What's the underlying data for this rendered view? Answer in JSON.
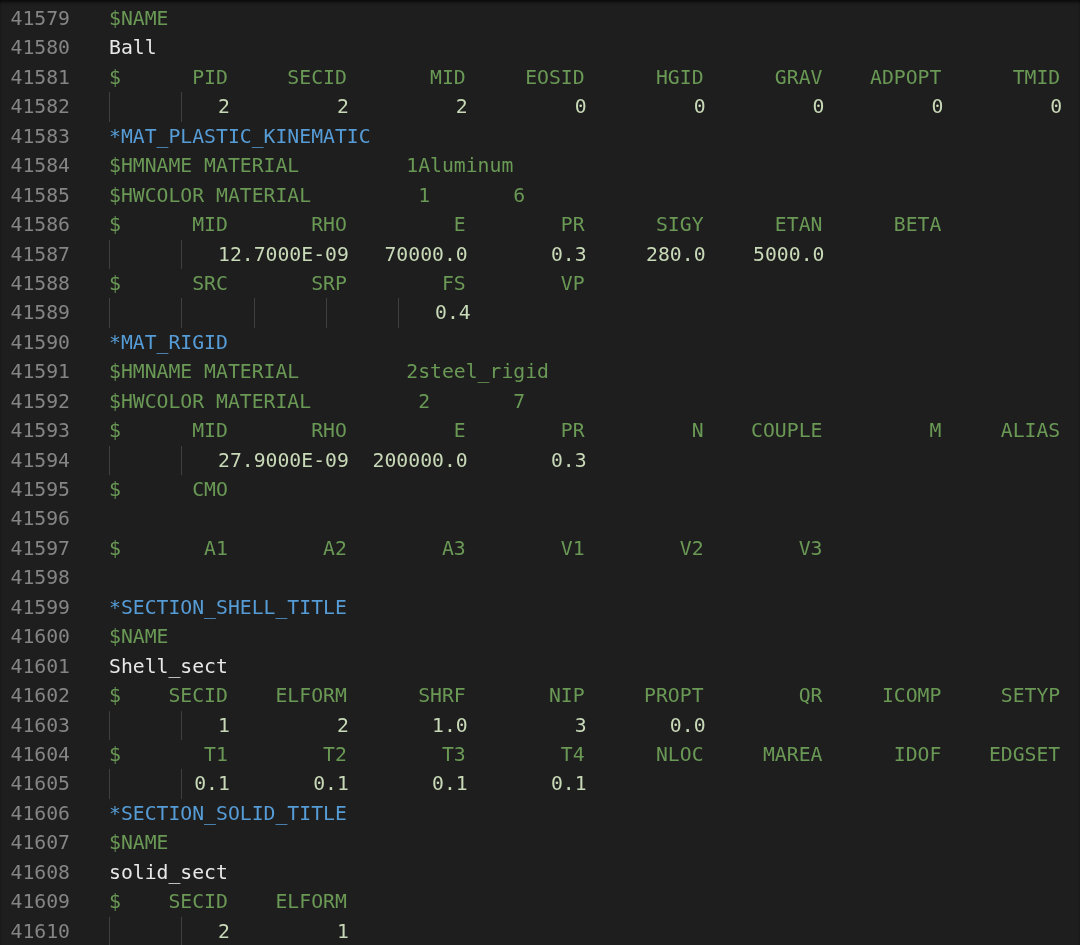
{
  "editor": {
    "lines": [
      {
        "number": "41579",
        "kind": "comment",
        "text": "$NAME"
      },
      {
        "number": "41580",
        "kind": "name",
        "text": "Ball"
      },
      {
        "number": "41581",
        "kind": "comment",
        "text": "$      PID     SECID       MID     EOSID      HGID      GRAV    ADPOPT      TMID"
      },
      {
        "number": "41582",
        "kind": "data",
        "text": "         2         2         2         0         0         0         0         0"
      },
      {
        "number": "41583",
        "kind": "keyword",
        "text": "*MAT_PLASTIC_KINEMATIC"
      },
      {
        "number": "41584",
        "kind": "comment",
        "text": "$HMNAME MATERIAL         1Aluminum"
      },
      {
        "number": "41585",
        "kind": "comment",
        "text": "$HWCOLOR MATERIAL         1       6"
      },
      {
        "number": "41586",
        "kind": "comment",
        "text": "$      MID       RHO         E        PR      SIGY      ETAN      BETA"
      },
      {
        "number": "41587",
        "kind": "data",
        "text": "         12.7000E-09   70000.0       0.3     280.0    5000.0"
      },
      {
        "number": "41588",
        "kind": "comment",
        "text": "$      SRC       SRP        FS        VP"
      },
      {
        "number": "41589",
        "kind": "data",
        "text": "                           0.4"
      },
      {
        "number": "41590",
        "kind": "keyword",
        "text": "*MAT_RIGID"
      },
      {
        "number": "41591",
        "kind": "comment",
        "text": "$HMNAME MATERIAL         2steel_rigid"
      },
      {
        "number": "41592",
        "kind": "comment",
        "text": "$HWCOLOR MATERIAL         2       7"
      },
      {
        "number": "41593",
        "kind": "comment",
        "text": "$      MID       RHO         E        PR         N    COUPLE         M     ALIAS"
      },
      {
        "number": "41594",
        "kind": "data",
        "text": "         27.9000E-09  200000.0       0.3"
      },
      {
        "number": "41595",
        "kind": "comment",
        "text": "$      CMO"
      },
      {
        "number": "41596",
        "kind": "blank"
      },
      {
        "number": "41597",
        "kind": "comment",
        "text": "$       A1        A2        A3        V1        V2        V3"
      },
      {
        "number": "41598",
        "kind": "blank"
      },
      {
        "number": "41599",
        "kind": "keyword",
        "text": "*SECTION_SHELL_TITLE"
      },
      {
        "number": "41600",
        "kind": "comment",
        "text": "$NAME"
      },
      {
        "number": "41601",
        "kind": "name",
        "text": "Shell_sect"
      },
      {
        "number": "41602",
        "kind": "comment",
        "text": "$    SECID    ELFORM      SHRF       NIP     PROPT        QR     ICOMP     SETYP"
      },
      {
        "number": "41603",
        "kind": "data",
        "text": "         1         2       1.0         3       0.0"
      },
      {
        "number": "41604",
        "kind": "comment",
        "text": "$       T1        T2        T3        T4      NLOC     MAREA      IDOF    EDGSET"
      },
      {
        "number": "41605",
        "kind": "data",
        "text": "       0.1       0.1       0.1       0.1"
      },
      {
        "number": "41606",
        "kind": "keyword",
        "text": "*SECTION_SOLID_TITLE"
      },
      {
        "number": "41607",
        "kind": "comment",
        "text": "$NAME"
      },
      {
        "number": "41608",
        "kind": "name",
        "text": "solid_sect"
      },
      {
        "number": "41609",
        "kind": "comment",
        "text": "$    SECID    ELFORM"
      },
      {
        "number": "41610",
        "kind": "data",
        "text": "         2         1"
      }
    ]
  }
}
